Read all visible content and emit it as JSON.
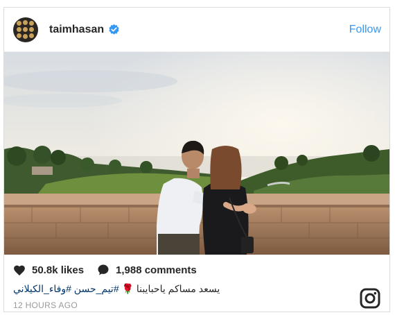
{
  "header": {
    "username": "taimhasan",
    "follow_label": "Follow",
    "avatar_icon": "avatar-portrait-grid",
    "verified_icon": "verified-badge-icon",
    "accent_color": "#3897f0"
  },
  "post": {
    "photo_alt": "couple-overlooking-golf-course",
    "likes": "50.8k likes",
    "comments": "1,988 comments",
    "caption_text": "يسعد مساكم ياحبايبنا",
    "caption_emoji": "🌹",
    "caption_tags": "#تيم_حسن #وفاء_الكيلاني",
    "timestamp": "12 HOURS AGO",
    "like_icon": "heart-icon",
    "comment_icon": "comment-bubble-icon",
    "brand_icon": "instagram-logo-icon"
  }
}
